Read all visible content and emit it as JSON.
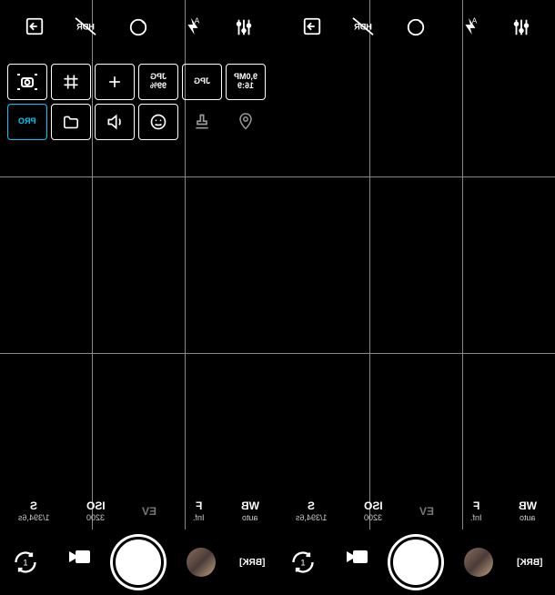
{
  "left": {
    "top_icons": [
      "export",
      "hdr",
      "timer",
      "flash",
      "settings"
    ],
    "settings_row1": [
      {
        "kind": "icon",
        "name": "camera-bracket"
      },
      {
        "kind": "icon",
        "name": "hash"
      },
      {
        "kind": "icon",
        "name": "plus"
      },
      {
        "kind": "text",
        "lines": [
          "JPG",
          "99%"
        ]
      },
      {
        "kind": "text",
        "lines": [
          "JPG"
        ]
      },
      {
        "kind": "text",
        "lines": [
          "9,0MP",
          "16:9"
        ]
      }
    ],
    "settings_row2": [
      {
        "kind": "pro",
        "text": "PRO"
      },
      {
        "kind": "icon",
        "name": "folder"
      },
      {
        "kind": "icon",
        "name": "sound"
      },
      {
        "kind": "icon",
        "name": "face"
      },
      {
        "kind": "icon",
        "name": "stamp",
        "noborder": true
      },
      {
        "kind": "icon",
        "name": "location",
        "noborder": true
      }
    ],
    "exposure": [
      {
        "label": "S",
        "value": "1/394,6s"
      },
      {
        "label": "ISO",
        "value": "3200"
      },
      {
        "label": "EV",
        "value": "",
        "cls": "ev"
      },
      {
        "label": "F",
        "value": "Inf."
      },
      {
        "label": "WB",
        "value": "auto"
      }
    ],
    "bottom": {
      "switch": "switch-camera",
      "video": "video-mode",
      "gallery": "gallery",
      "brk": "[BRK]"
    }
  },
  "right": {
    "top_icons": [
      "export",
      "hdr",
      "timer",
      "flash",
      "settings"
    ],
    "exposure": [
      {
        "label": "S",
        "value": "1/394,6s"
      },
      {
        "label": "ISO",
        "value": "3200"
      },
      {
        "label": "EV",
        "value": "",
        "cls": "ev"
      },
      {
        "label": "F",
        "value": "Inf."
      },
      {
        "label": "WB",
        "value": "auto"
      }
    ],
    "bottom": {
      "switch": "switch-camera",
      "video": "video-mode",
      "gallery": "gallery",
      "brk": "[BRK]"
    }
  }
}
